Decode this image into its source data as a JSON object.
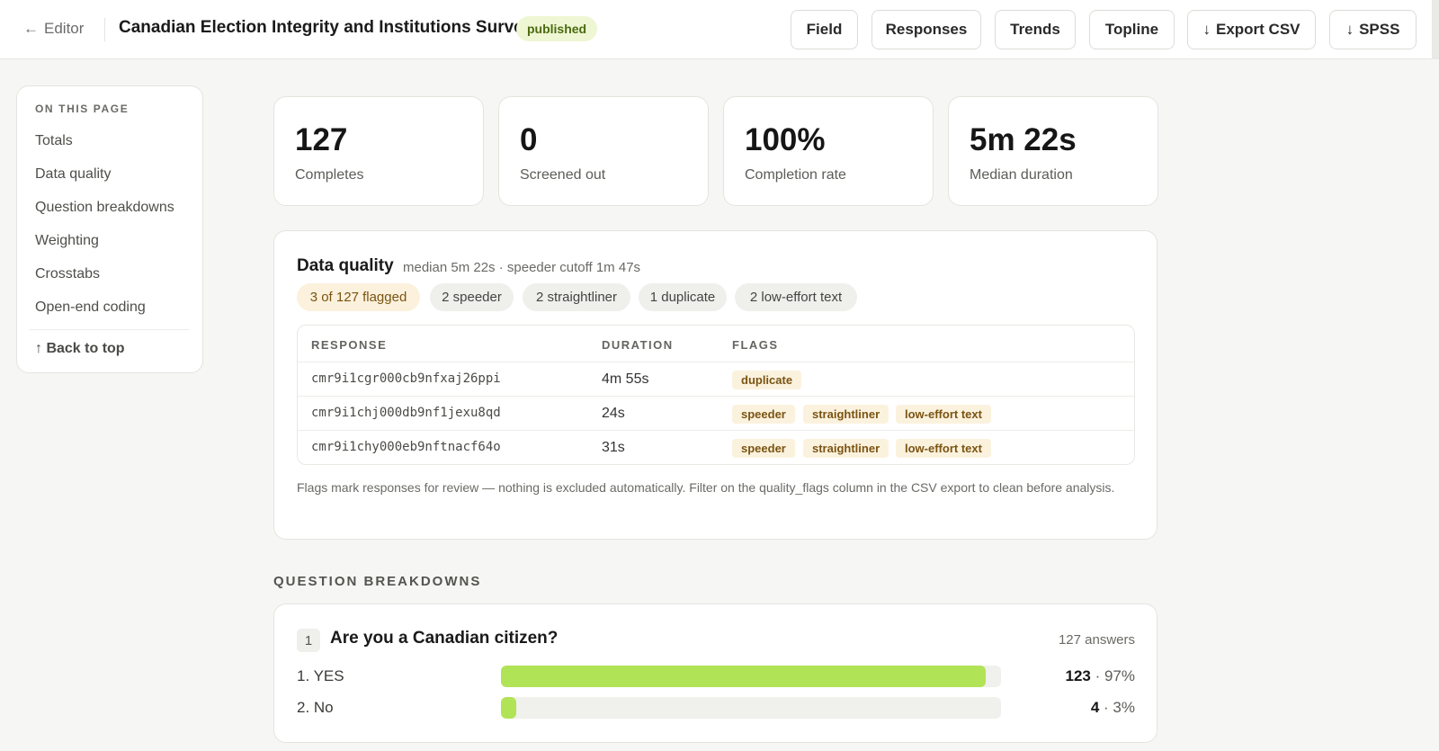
{
  "header": {
    "back_label": "Editor",
    "back_icon": "arrow-left-icon",
    "title": "Canadian Election Integrity and Institutions Survey",
    "status": "published",
    "buttons": {
      "field": "Field",
      "responses": "Responses",
      "trends": "Trends",
      "topline": "Topline",
      "export_csv": "Export CSV",
      "spss": "SPSS"
    }
  },
  "sidebar": {
    "heading": "ON THIS PAGE",
    "items": [
      "Totals",
      "Data quality",
      "Question breakdowns",
      "Weighting",
      "Crosstabs",
      "Open-end coding"
    ],
    "back_to_top": "Back to top"
  },
  "stats": [
    {
      "value": "127",
      "label": "Completes"
    },
    {
      "value": "0",
      "label": "Screened out"
    },
    {
      "value": "100%",
      "label": "Completion rate"
    },
    {
      "value": "5m 22s",
      "label": "Median duration"
    }
  ],
  "data_quality": {
    "title": "Data quality",
    "subtitle": "median 5m 22s · speeder cutoff 1m 47s",
    "chips": {
      "flagged": "3 of 127 flagged",
      "speeder": "2 speeder",
      "straightliner": "2 straightliner",
      "duplicate": "1 duplicate",
      "low_effort": "2 low-effort text"
    },
    "columns": {
      "response": "RESPONSE",
      "duration": "DURATION",
      "flags": "FLAGS"
    },
    "rows": [
      {
        "id": "cmr9i1cgr000cb9nfxaj26ppi",
        "duration": "4m 55s",
        "flags": [
          "duplicate"
        ]
      },
      {
        "id": "cmr9i1chj000db9nf1jexu8qd",
        "duration": "24s",
        "flags": [
          "speeder",
          "straightliner",
          "low-effort text"
        ]
      },
      {
        "id": "cmr9i1chy000eb9nftnacf64o",
        "duration": "31s",
        "flags": [
          "speeder",
          "straightliner",
          "low-effort text"
        ]
      }
    ],
    "note": "Flags mark responses for review — nothing is excluded automatically. Filter on the quality_flags column in the CSV export to clean before analysis."
  },
  "breakdowns": {
    "heading": "QUESTION BREAKDOWNS",
    "question": {
      "number": "1",
      "text": "Are you a Canadian citizen?",
      "answers": "127 answers",
      "options": [
        {
          "label": "1. YES",
          "count": "123",
          "pct": "97%",
          "share": 0.97
        },
        {
          "label": "2. No",
          "count": "4",
          "pct": "3%",
          "share": 0.03
        }
      ]
    }
  },
  "colors": {
    "accent": "#b1e356",
    "flag_bg": "#fbf2de",
    "flag_text": "#7a5412"
  }
}
